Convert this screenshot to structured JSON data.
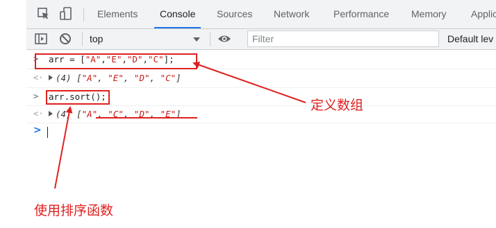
{
  "tabs": [
    "Elements",
    "Console",
    "Sources",
    "Network",
    "Performance",
    "Memory",
    "Applic"
  ],
  "active_tab": "Console",
  "toolbar": {
    "context": "top",
    "filter_placeholder": "Filter",
    "levels": "Default lev"
  },
  "console": {
    "lines": [
      {
        "type": "input",
        "prefix": "arr = [",
        "items": [
          "\"A\"",
          "\"E\"",
          "\"D\"",
          "\"C\""
        ],
        "suffix": "];"
      },
      {
        "type": "output",
        "count": "(4)",
        "items": [
          "\"A\"",
          "\"E\"",
          "\"D\"",
          "\"C\""
        ]
      },
      {
        "type": "input",
        "code": "arr.sort();"
      },
      {
        "type": "output",
        "count": "(4)",
        "items": [
          "\"A\"",
          "\"C\"",
          "\"D\"",
          "\"E\""
        ]
      }
    ],
    "prompt": ">"
  },
  "annotations": {
    "define_array": "定义数组",
    "use_sort": "使用排序函数",
    "color": "#e02020"
  },
  "icons": [
    "inspect-icon",
    "device-toggle-icon",
    "sidebar-toggle-icon",
    "clear-console-icon",
    "eye-icon"
  ]
}
